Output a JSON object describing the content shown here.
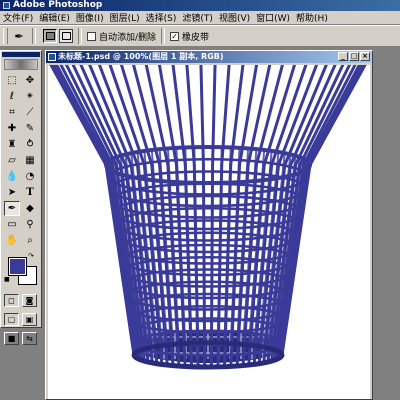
{
  "app": {
    "title": "Adobe Photoshop"
  },
  "menu": [
    {
      "label": "文件(F)"
    },
    {
      "label": "编辑(E)"
    },
    {
      "label": "图像(I)"
    },
    {
      "label": "图层(L)"
    },
    {
      "label": "选择(S)"
    },
    {
      "label": "滤镜(T)"
    },
    {
      "label": "视图(V)"
    },
    {
      "label": "窗口(W)"
    },
    {
      "label": "帮助(H)"
    }
  ],
  "options": {
    "auto_add_delete": "自动添加/删除",
    "rubber_band": "橡皮带",
    "rubber_band_checked": "✓"
  },
  "document": {
    "title": "未标题-1.psd @ 100%(图层 1 副本, RGB)"
  },
  "colors": {
    "foreground": "#3a3a98",
    "background": "#ffffff",
    "basket": "#3a3a98",
    "basket_dark": "#2a2a7a"
  },
  "icons": {
    "toolbar": [
      "marquee-icon",
      "move-icon",
      "lasso-icon",
      "magic-wand-icon",
      "crop-icon",
      "slice-icon",
      "healing-icon",
      "brush-icon",
      "clone-stamp-icon",
      "history-brush-icon",
      "eraser-icon",
      "gradient-icon",
      "blur-icon",
      "dodge-icon",
      "path-select-icon",
      "type-icon",
      "pen-icon",
      "shape-icon",
      "notes-icon",
      "eyedropper-icon",
      "hand-icon",
      "zoom-icon"
    ]
  }
}
